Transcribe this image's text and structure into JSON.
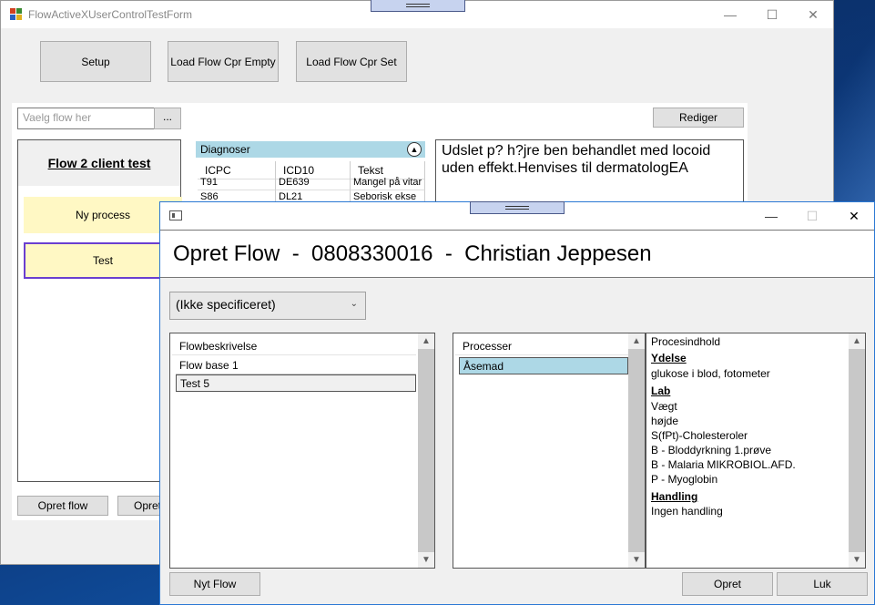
{
  "main_window": {
    "title": "FlowActiveXUserControlTestForm",
    "buttons": {
      "setup": "Setup",
      "load_empty": "Load Flow Cpr Empty",
      "load_set": "Load Flow Cpr Set",
      "browse": "...",
      "rediger": "Rediger",
      "opret_flow": "Opret flow",
      "opret_partial": "Opret"
    },
    "flow_search_placeholder": "Vaelg flow her",
    "flow_panel": {
      "title": "Flow 2 client test",
      "processes": [
        "Ny process",
        "Test"
      ]
    },
    "diagnoses": {
      "title": "Diagnoser",
      "columns": [
        "ICPC",
        "ICD10",
        "Tekst"
      ],
      "rows": [
        [
          "T91",
          "DE639",
          "Mangel på vitar"
        ],
        [
          "S86",
          "DL21",
          "Seborisk ekse"
        ]
      ]
    },
    "note_text": "Udslet p? h?jre ben behandlet med locoid uden effekt.Henvises til dermatologEA"
  },
  "dialog": {
    "header": "Opret Flow  -  0808330016  -  Christian Jeppesen",
    "combo_value": "(Ikke specificeret)",
    "flow_list": {
      "column": "Flowbeskrivelse",
      "items": [
        "Flow base 1",
        "Test 5"
      ]
    },
    "process_list": {
      "column": "Processer",
      "items": [
        "Åsemad"
      ]
    },
    "content": {
      "title": "Procesindhold",
      "sections": [
        {
          "heading": "Ydelse",
          "items": [
            "glukose i blod, fotometer"
          ]
        },
        {
          "heading": "Lab",
          "items": [
            "Vægt",
            "højde",
            "S(fPt)-Cholesteroler",
            "B - Bloddyrkning 1.prøve",
            "B - Malaria MIKROBIOL.AFD.",
            "P - Myoglobin"
          ]
        },
        {
          "heading": "Handling",
          "items": [
            "Ingen handling"
          ]
        }
      ]
    },
    "buttons": {
      "nyt_flow": "Nyt Flow",
      "opret": "Opret",
      "luk": "Luk"
    }
  },
  "icons": {
    "minimize": "—",
    "maximize": "☐",
    "close": "✕",
    "scroll_up": "▲",
    "scroll_down": "▼",
    "collapse": "▲",
    "dropdown": "⌄"
  },
  "colors": {
    "selected_item": "#add8e6",
    "process_item": "#fff8c4",
    "active_border": "#6a3fd0",
    "dialog_border": "#2b78d4"
  }
}
